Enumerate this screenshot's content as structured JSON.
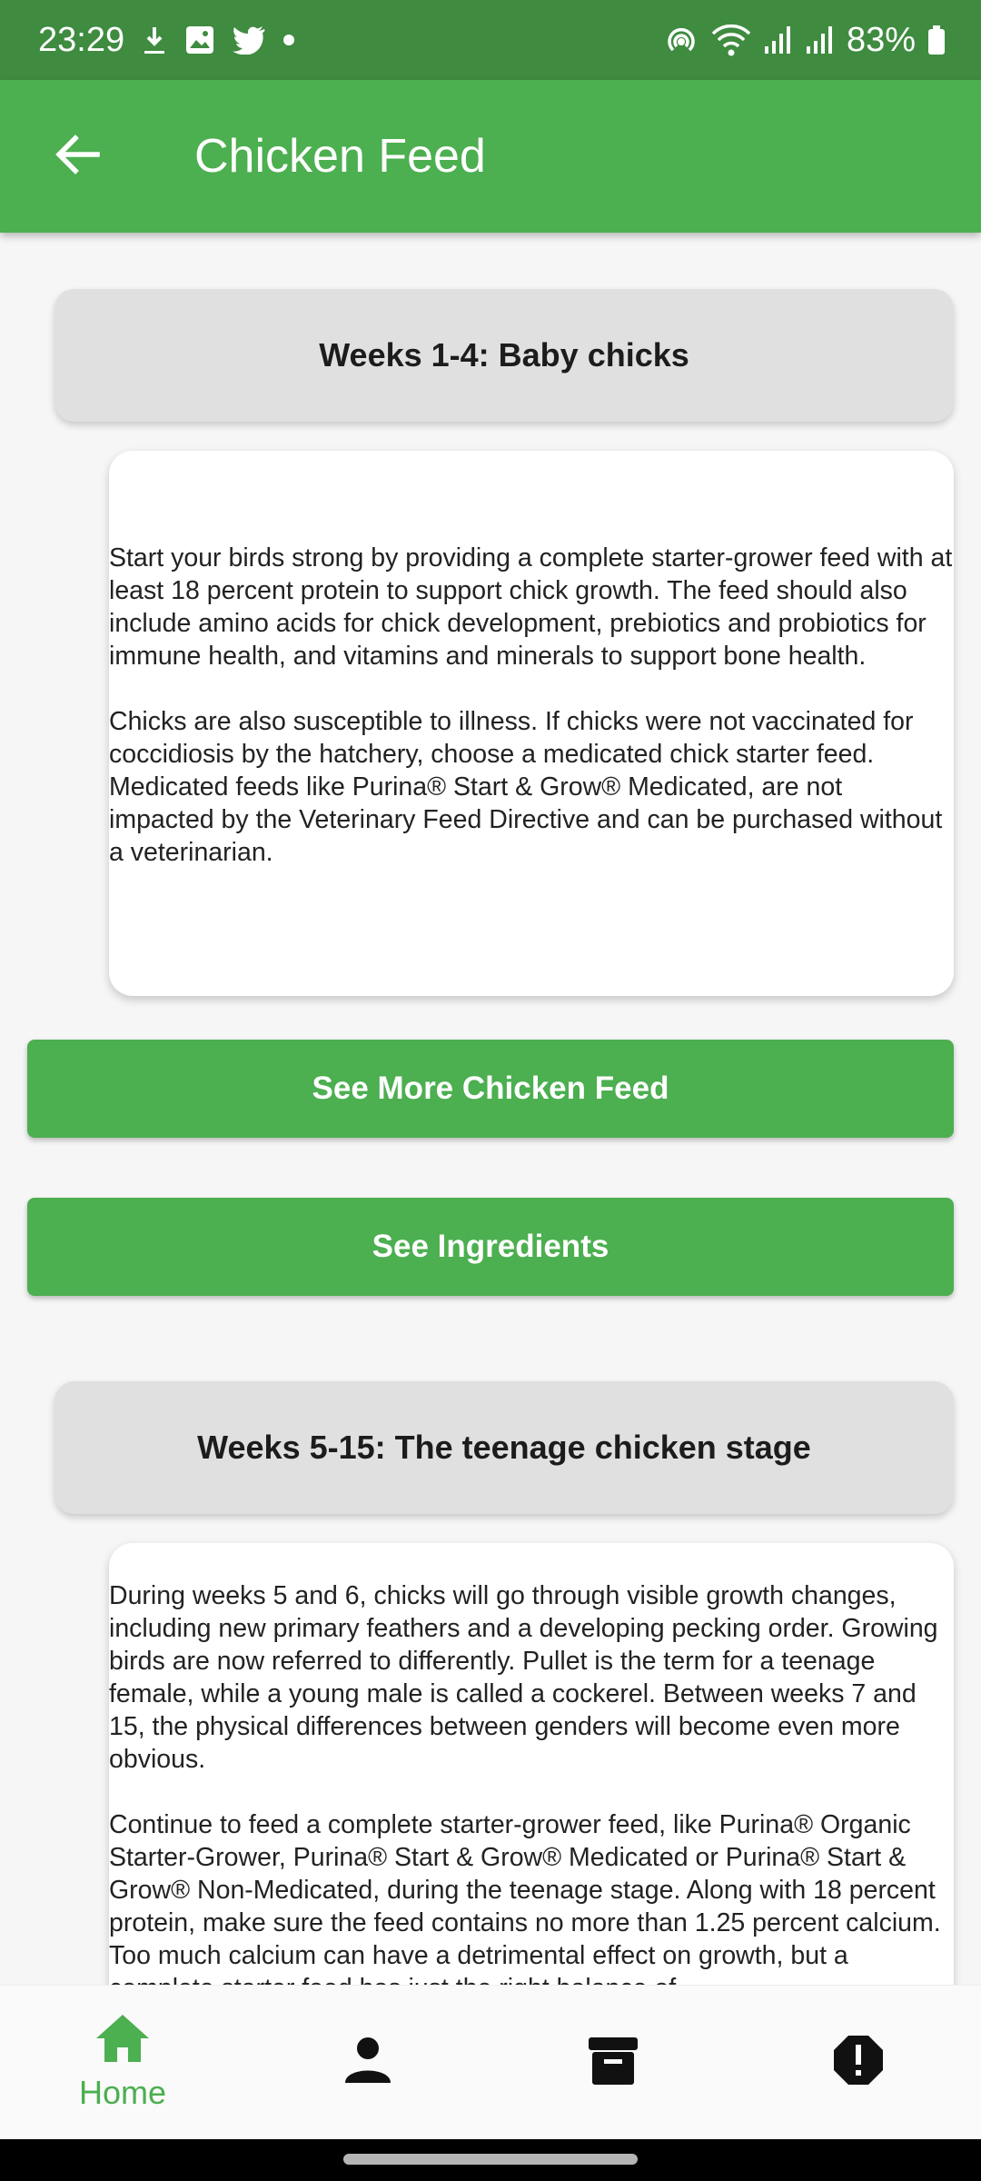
{
  "status_bar": {
    "time": "23:29",
    "battery": "83%"
  },
  "app_bar": {
    "title": "Chicken Feed"
  },
  "sections": [
    {
      "header": "Weeks 1-4: Baby chicks",
      "paragraphs": [
        "Start your birds strong by providing a complete starter-grower feed with at least 18 percent protein to support chick growth. The feed should also include amino acids for chick development, prebiotics and probiotics for immune health, and vitamins and minerals to support bone health.",
        "Chicks are also susceptible to illness. If chicks were not vaccinated for coccidiosis by the hatchery, choose a medicated chick starter feed. Medicated feeds like Purina® Start & Grow® Medicated, are not impacted by the Veterinary Feed Directive and can be purchased without a veterinarian."
      ]
    },
    {
      "header": "Weeks 5-15: The teenage chicken stage",
      "paragraphs": [
        "During weeks 5 and 6, chicks will go through visible growth changes, including new primary feathers and a developing pecking order. Growing birds are now referred to differently. Pullet is the term for a teenage female, while a young male is called a cockerel. Between weeks 7 and 15, the physical differences between genders will become even more obvious.",
        "Continue to feed a complete starter-grower feed, like Purina® Organic Starter-Grower, Purina® Start & Grow® Medicated or Purina® Start & Grow® Non-Medicated, during the teenage stage. Along with 18 percent protein, make sure the feed contains no more than 1.25 percent calcium. Too much calcium can have a detrimental effect on growth, but a complete starter feed has just the right balance of"
      ]
    }
  ],
  "buttons": {
    "see_more": "See More Chicken Feed",
    "see_ingredients": "See Ingredients"
  },
  "bottom_nav": {
    "home_label": "Home",
    "icons": [
      "home-icon",
      "person-icon",
      "archive-icon",
      "alert-icon"
    ]
  },
  "colors": {
    "primary": "#4caf50",
    "status_bar": "#3f8b40",
    "header_card": "#e0e0e0"
  }
}
